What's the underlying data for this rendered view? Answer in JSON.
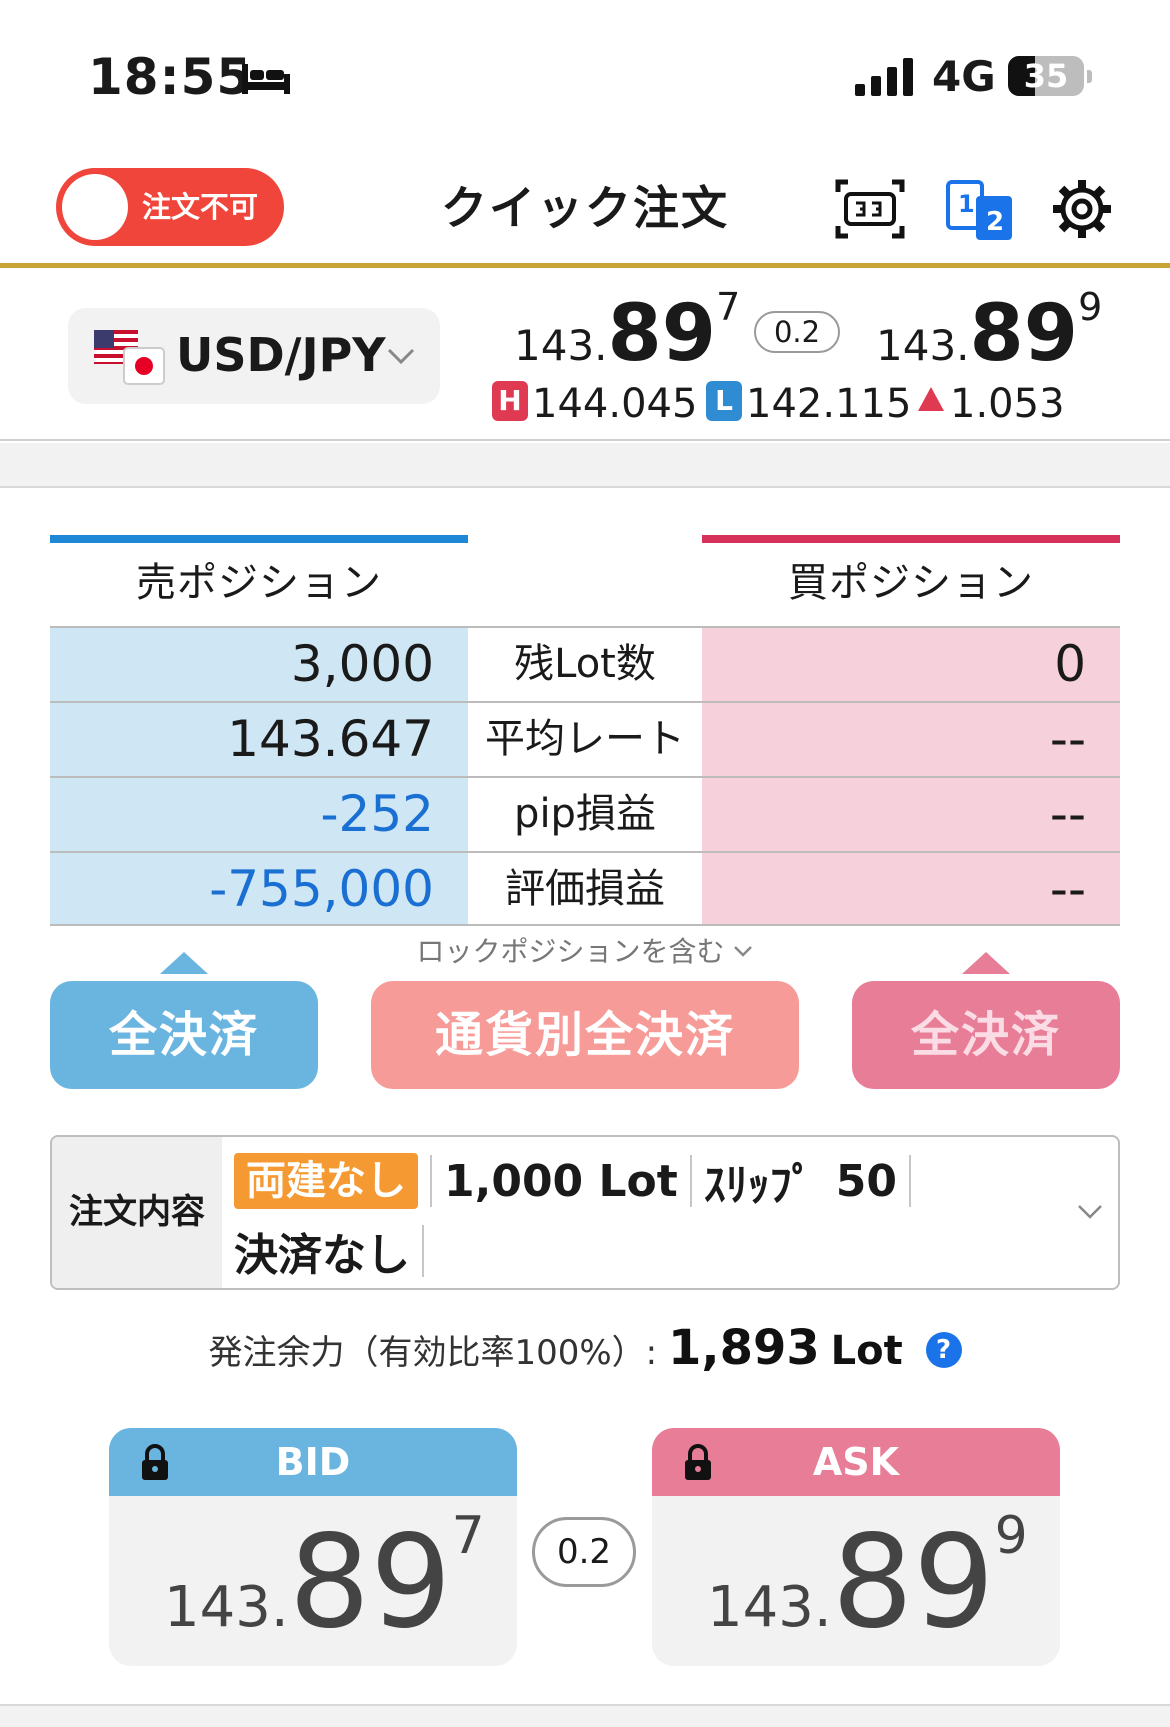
{
  "status_bar": {
    "time": "18:55",
    "network": "4G",
    "battery": "35",
    "battery_level": 0.35
  },
  "header": {
    "toggle_label": "注文不可",
    "title": "クイック注文"
  },
  "quote": {
    "pair": "USD/JPY",
    "bid": {
      "int": "143.",
      "big": "89",
      "sup": "7"
    },
    "ask": {
      "int": "143.",
      "big": "89",
      "sup": "9"
    },
    "spread": "0.2",
    "high_badge": "H",
    "high": "144.045",
    "low_badge": "L",
    "low": "142.115",
    "change": "1.053"
  },
  "positions": {
    "sell_title": "売ポジション",
    "buy_title": "買ポジション",
    "rows": [
      {
        "label": "残Lot数",
        "sell": "3,000",
        "buy": "0"
      },
      {
        "label": "平均レート",
        "sell": "143.647",
        "buy": "--"
      },
      {
        "label": "pip損益",
        "sell": "-252",
        "buy": "--"
      },
      {
        "label": "評価損益",
        "sell": "-755,000",
        "buy": "--"
      }
    ],
    "lock_note": "ロックポジションを含む"
  },
  "actions": {
    "close_sell": "全決済",
    "close_currency": "通貨別全決済",
    "close_buy": "全決済"
  },
  "order": {
    "label": "注文内容",
    "tag": "両建なし",
    "lot": "1,000 Lot",
    "slip_label": "ｽﾘｯﾌﾟ",
    "slip_value": "50",
    "settle": "決済なし"
  },
  "margin": {
    "label": "発注余力（有効比率100%）:",
    "value": "1,893",
    "unit": "Lot",
    "help": "?"
  },
  "order_buttons": {
    "bid_label": "BID",
    "ask_label": "ASK",
    "bid": {
      "int": "143.",
      "big": "89",
      "sup": "7"
    },
    "ask": {
      "int": "143.",
      "big": "89",
      "sup": "9"
    },
    "spread": "0.2"
  }
}
